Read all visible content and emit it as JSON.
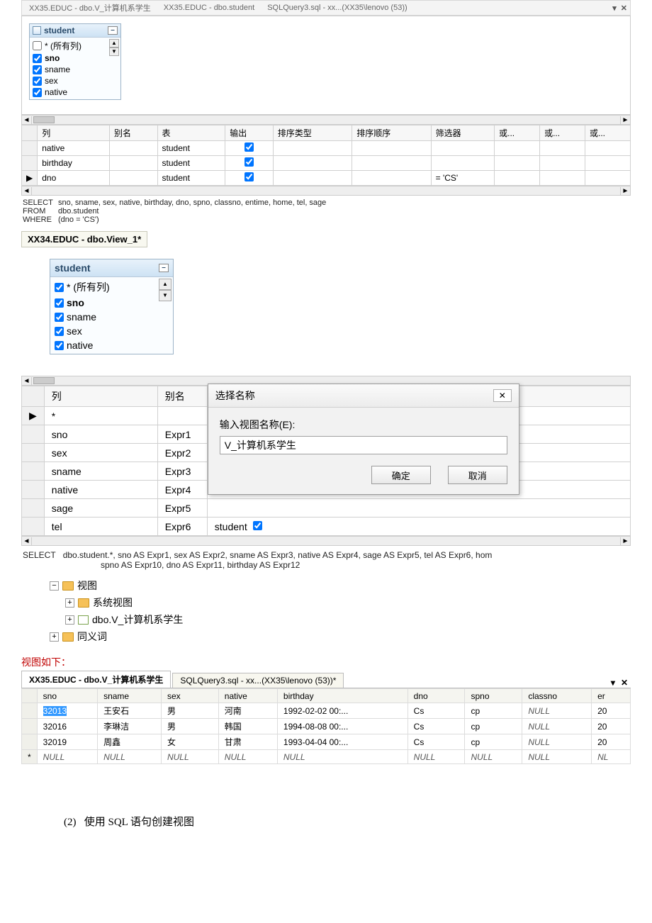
{
  "topTabs": {
    "t1": "XX35.EDUC - dbo.V_计算机系学生",
    "t2": "XX35.EDUC - dbo.student",
    "t3": "SQLQuery3.sql - xx...(XX35\\lenovo (53))"
  },
  "studentTableSmall": {
    "title": "student",
    "all": "* (所有列)",
    "c1": "sno",
    "c2": "sname",
    "c3": "sex",
    "c4": "native"
  },
  "gridHeaders": {
    "col": "列",
    "alias": "别名",
    "table": "表",
    "output": "输出",
    "sortType": "排序类型",
    "sortOrder": "排序顺序",
    "filter": "筛选器",
    "or1": "或...",
    "or2": "或...",
    "or3": "或..."
  },
  "gridRows": {
    "r1": {
      "col": "native",
      "table": "student"
    },
    "r2": {
      "col": "birthday",
      "table": "student"
    },
    "r3": {
      "col": "dno",
      "table": "student",
      "filter": "= 'CS'"
    }
  },
  "sqlBlock": {
    "select": "SELECT",
    "selectVal": "sno, sname, sex, native, birthday, dno, spno, classno, entime, home, tel, sage",
    "from": "FROM",
    "fromVal": "dbo.student",
    "where": "WHERE",
    "whereVal": "(dno = 'CS')"
  },
  "view1Tab": "XX34.EDUC - dbo.View_1*",
  "studentTableBig": {
    "title": "student",
    "all": "* (所有列)",
    "c1": "sno",
    "c2": "sname",
    "c3": "sex",
    "c4": "native"
  },
  "nameGrid": {
    "h_col": "列",
    "h_alias": "别名",
    "rows": {
      "r0": {
        "col": "*",
        "alias": ""
      },
      "r1": {
        "col": "sno",
        "alias": "Expr1"
      },
      "r2": {
        "col": "sex",
        "alias": "Expr2"
      },
      "r3": {
        "col": "sname",
        "alias": "Expr3"
      },
      "r4": {
        "col": "native",
        "alias": "Expr4"
      },
      "r5": {
        "col": "sage",
        "alias": "Expr5"
      },
      "r6": {
        "col": "tel",
        "alias": "Expr6",
        "table": "student"
      }
    }
  },
  "nameDialog": {
    "title": "选择名称",
    "label": "输入视图名称(E):",
    "value": "V_计算机系学生",
    "ok": "确定",
    "cancel": "取消"
  },
  "selectLine": {
    "kw": "SELECT",
    "txt1": "dbo.student.*, sno AS Expr1, sex AS Expr2, sname AS Expr3, native AS Expr4, sage AS Expr5, tel AS Expr6, hom",
    "txt2": "spno AS Expr10, dno AS Expr11, birthday AS Expr12"
  },
  "tree": {
    "views": "视图",
    "sysviews": "系统视图",
    "viewname": "dbo.V_计算机系学生",
    "synonyms": "同义词"
  },
  "resultTitle": "视图如下：",
  "resultTabs": {
    "t1": "XX35.EDUC - dbo.V_计算机系学生",
    "t2": "SQLQuery3.sql - xx...(XX35\\lenovo (53))*"
  },
  "resultHeaders": {
    "sno": "sno",
    "sname": "sname",
    "sex": "sex",
    "native": "native",
    "birthday": "birthday",
    "dno": "dno",
    "spno": "spno",
    "classno": "classno",
    "er": "er"
  },
  "resultRows": {
    "r1": {
      "sno": "32013",
      "sname": "王安石",
      "sex": "男",
      "native": "河南",
      "birthday": "1992-02-02 00:...",
      "dno": "Cs",
      "spno": "cp",
      "classno": "NULL",
      "er": "20"
    },
    "r2": {
      "sno": "32016",
      "sname": "李琳洁",
      "sex": "男",
      "native": "韩国",
      "birthday": "1994-08-08 00:...",
      "dno": "Cs",
      "spno": "cp",
      "classno": "NULL",
      "er": "20"
    },
    "r3": {
      "sno": "32019",
      "sname": "周鑫",
      "sex": "女",
      "native": "甘肃",
      "birthday": "1993-04-04 00:...",
      "dno": "Cs",
      "spno": "cp",
      "classno": "NULL",
      "er": "20"
    },
    "r4": {
      "sno": "NULL",
      "sname": "NULL",
      "sex": "NULL",
      "native": "NULL",
      "birthday": "NULL",
      "dno": "NULL",
      "spno": "NULL",
      "classno": "NULL",
      "er": "NL"
    }
  },
  "footer": {
    "num": "(2)",
    "txt": "使用 SQL 语句创建视图"
  }
}
